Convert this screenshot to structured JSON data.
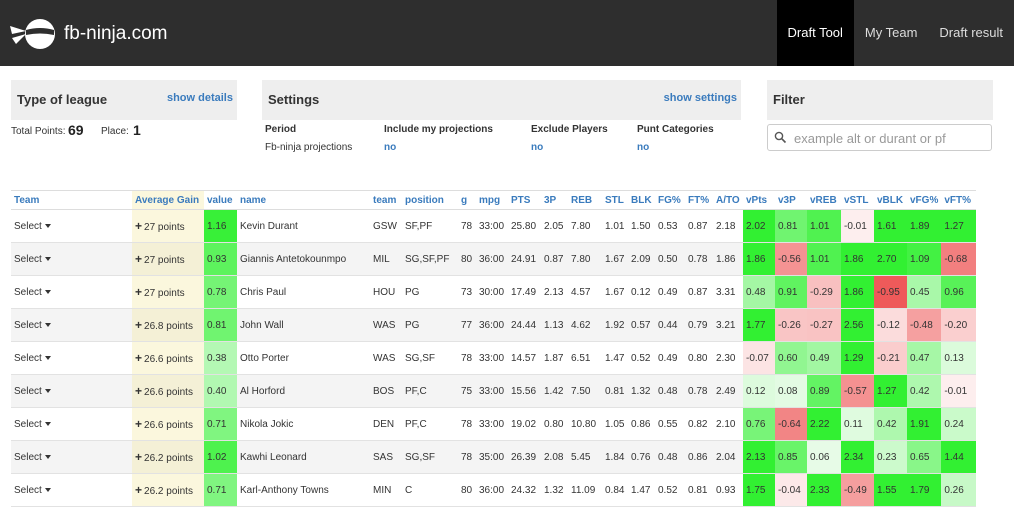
{
  "app": {
    "brand": "fb-ninja.com",
    "nav": [
      {
        "label": "Draft Tool",
        "active": true
      },
      {
        "label": "My Team",
        "active": false
      },
      {
        "label": "Draft result",
        "active": false
      }
    ]
  },
  "league": {
    "title": "Type of league",
    "link": "show details",
    "total_points_label": "Total Points:",
    "total_points": "69",
    "place_label": "Place:",
    "place": "1"
  },
  "settings": {
    "title": "Settings",
    "link": "show settings",
    "columns": [
      {
        "header": "Period",
        "value": "Fb-ninja projections",
        "value_is_link": false
      },
      {
        "header": "Include my projections",
        "value": "no",
        "value_is_link": true
      },
      {
        "header": "Exclude Players",
        "value": "no",
        "value_is_link": true
      },
      {
        "header": "Punt Categories",
        "value": "no",
        "value_is_link": true
      }
    ]
  },
  "filter": {
    "title": "Filter",
    "placeholder": "example alt or durant or pf"
  },
  "table": {
    "select_label": "Select",
    "headers": [
      "Team",
      "Average Gain",
      "value",
      "name",
      "team",
      "position",
      "g",
      "mpg",
      "PTS",
      "3P",
      "REB",
      "STL",
      "BLK",
      "FG%",
      "FT%",
      "A/TO",
      "vPts",
      "v3P",
      "vREB",
      "vSTL",
      "vBLK",
      "vFG%",
      "vFT%"
    ],
    "rows": [
      {
        "gain": "27 points",
        "value": "1.16",
        "name": "Kevin Durant",
        "team": "GSW",
        "position": "SF,PF",
        "g": "78",
        "mpg": "33:00",
        "pts": "25.80",
        "tp": "2.05",
        "reb": "7.80",
        "stl": "1.01",
        "blk": "1.50",
        "fg": "0.53",
        "ft": "0.87",
        "ato": "2.18",
        "v": [
          "2.02",
          "0.81",
          "1.01",
          "-0.01",
          "1.61",
          "1.89",
          "1.27"
        ]
      },
      {
        "gain": "27 points",
        "value": "0.93",
        "name": "Giannis Antetokounmpo",
        "team": "MIL",
        "position": "SG,SF,PF",
        "g": "80",
        "mpg": "36:00",
        "pts": "24.91",
        "tp": "0.87",
        "reb": "7.80",
        "stl": "1.67",
        "blk": "2.09",
        "fg": "0.50",
        "ft": "0.78",
        "ato": "1.86",
        "v": [
          "1.86",
          "-0.56",
          "1.01",
          "1.86",
          "2.70",
          "1.09",
          "-0.68"
        ]
      },
      {
        "gain": "27 points",
        "value": "0.78",
        "name": "Chris Paul",
        "team": "HOU",
        "position": "PG",
        "g": "73",
        "mpg": "30:00",
        "pts": "17.49",
        "tp": "2.13",
        "reb": "4.57",
        "stl": "1.67",
        "blk": "0.12",
        "fg": "0.49",
        "ft": "0.87",
        "ato": "3.31",
        "v": [
          "0.48",
          "0.91",
          "-0.29",
          "1.86",
          "-0.95",
          "0.45",
          "0.96"
        ]
      },
      {
        "gain": "26.8 points",
        "value": "0.81",
        "name": "John Wall",
        "team": "WAS",
        "position": "PG",
        "g": "77",
        "mpg": "36:00",
        "pts": "24.44",
        "tp": "1.13",
        "reb": "4.62",
        "stl": "1.92",
        "blk": "0.57",
        "fg": "0.44",
        "ft": "0.79",
        "ato": "3.21",
        "v": [
          "1.77",
          "-0.26",
          "-0.27",
          "2.56",
          "-0.12",
          "-0.48",
          "-0.20"
        ]
      },
      {
        "gain": "26.6 points",
        "value": "0.38",
        "name": "Otto Porter",
        "team": "WAS",
        "position": "SG,SF",
        "g": "78",
        "mpg": "33:00",
        "pts": "14.57",
        "tp": "1.87",
        "reb": "6.51",
        "stl": "1.47",
        "blk": "0.52",
        "fg": "0.49",
        "ft": "0.80",
        "ato": "2.30",
        "v": [
          "-0.07",
          "0.60",
          "0.49",
          "1.29",
          "-0.21",
          "0.47",
          "0.13"
        ]
      },
      {
        "gain": "26.6 points",
        "value": "0.40",
        "name": "Al Horford",
        "team": "BOS",
        "position": "PF,C",
        "g": "75",
        "mpg": "33:00",
        "pts": "15.56",
        "tp": "1.42",
        "reb": "7.50",
        "stl": "0.81",
        "blk": "1.32",
        "fg": "0.48",
        "ft": "0.78",
        "ato": "2.49",
        "v": [
          "0.12",
          "0.08",
          "0.89",
          "-0.57",
          "1.27",
          "0.42",
          "-0.01"
        ]
      },
      {
        "gain": "26.6 points",
        "value": "0.71",
        "name": "Nikola Jokic",
        "team": "DEN",
        "position": "PF,C",
        "g": "78",
        "mpg": "33:00",
        "pts": "19.02",
        "tp": "0.80",
        "reb": "10.80",
        "stl": "1.05",
        "blk": "0.86",
        "fg": "0.55",
        "ft": "0.82",
        "ato": "2.10",
        "v": [
          "0.76",
          "-0.64",
          "2.22",
          "0.11",
          "0.42",
          "1.91",
          "0.24"
        ]
      },
      {
        "gain": "26.2 points",
        "value": "1.02",
        "name": "Kawhi Leonard",
        "team": "SAS",
        "position": "SG,SF",
        "g": "78",
        "mpg": "35:00",
        "pts": "26.39",
        "tp": "2.08",
        "reb": "5.45",
        "stl": "1.84",
        "blk": "0.76",
        "fg": "0.48",
        "ft": "0.86",
        "ato": "2.04",
        "v": [
          "2.13",
          "0.85",
          "0.06",
          "2.34",
          "0.23",
          "0.65",
          "1.44"
        ]
      },
      {
        "gain": "26.2 points",
        "value": "0.71",
        "name": "Karl-Anthony Towns",
        "team": "MIN",
        "position": "C",
        "g": "80",
        "mpg": "36:00",
        "pts": "24.32",
        "tp": "1.32",
        "reb": "11.09",
        "stl": "0.84",
        "blk": "1.47",
        "fg": "0.52",
        "ft": "0.81",
        "ato": "0.93",
        "v": [
          "1.75",
          "-0.04",
          "2.33",
          "-0.49",
          "1.55",
          "1.79",
          "0.26"
        ]
      }
    ]
  },
  "colors": {
    "topbar": "#2e2e2e",
    "link": "#3a7bbd",
    "gain_bg": "#fbf7dd",
    "positive": "#33ee33",
    "negative": "#ee5a5a"
  }
}
